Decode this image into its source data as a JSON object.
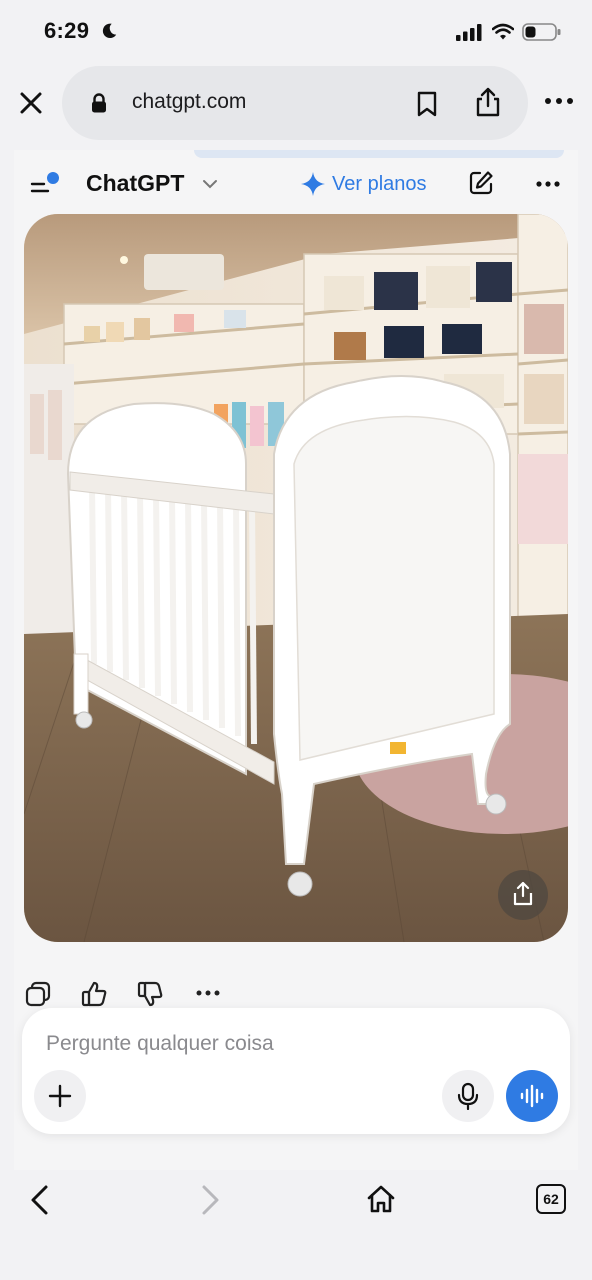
{
  "status_bar": {
    "time": "6:29"
  },
  "browser": {
    "url": "chatgpt.com",
    "tabs_count": "62"
  },
  "chat": {
    "app_title": "ChatGPT",
    "plans_label": "Ver planos",
    "composer_placeholder": "Pergunte qualquer coisa"
  },
  "image": {
    "description_icon": "photo of white baby crib in store"
  },
  "colors": {
    "accent": "#2f7be3",
    "page_bg": "#f2f2f4",
    "url_pill": "#e6e7ea"
  },
  "icons": [
    "moon-icon",
    "signal-icon",
    "wifi-icon",
    "battery-icon",
    "close-icon",
    "lock-icon",
    "bookmark-icon",
    "share-icon",
    "more-icon",
    "menu-icon",
    "chevron-down-icon",
    "sparkle-icon",
    "new-chat-icon",
    "copy-icon",
    "thumbs-up-icon",
    "thumbs-down-icon",
    "plus-icon",
    "mic-icon",
    "voice-waveform-icon",
    "back-icon",
    "forward-icon",
    "home-icon",
    "tabs-icon"
  ]
}
